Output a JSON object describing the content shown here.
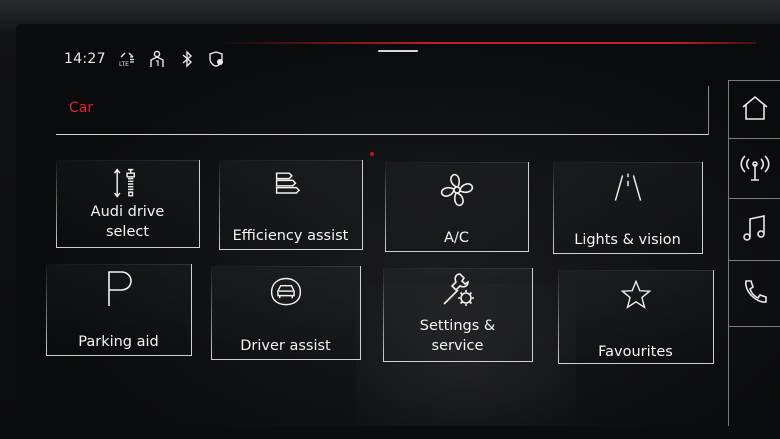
{
  "status": {
    "time": "14:27",
    "icons": [
      "lte-signal-icon",
      "user-icon",
      "bluetooth-icon",
      "location-shield-icon"
    ]
  },
  "header": {
    "title": "Car"
  },
  "tiles": [
    {
      "label_line1": "Audi drive",
      "label_line2": "select",
      "icon": "suspension-icon"
    },
    {
      "label_line1": "Efficiency assist",
      "label_line2": "",
      "icon": "efficiency-bars-icon"
    },
    {
      "label_line1": "A/C",
      "label_line2": "",
      "icon": "fan-icon"
    },
    {
      "label_line1": "Lights & vision",
      "label_line2": "",
      "icon": "road-lights-icon"
    },
    {
      "label_line1": "Parking aid",
      "label_line2": "",
      "icon": "parking-p-icon"
    },
    {
      "label_line1": "Driver assist",
      "label_line2": "",
      "icon": "car-sensor-icon"
    },
    {
      "label_line1": "Settings &",
      "label_line2": "service",
      "icon": "wrench-gear-icon"
    },
    {
      "label_line1": "Favourites",
      "label_line2": "",
      "icon": "star-icon"
    }
  ],
  "rail": [
    "home-icon",
    "radio-icon",
    "music-icon",
    "phone-icon"
  ],
  "colors": {
    "accent": "#e2202f",
    "line": "#cfcfcf",
    "text": "#f4f4f4"
  }
}
